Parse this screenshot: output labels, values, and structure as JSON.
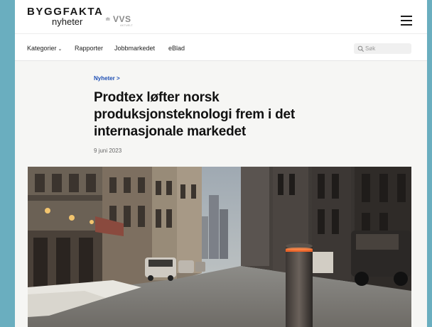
{
  "header": {
    "brand_main": "BYGGFAKTA",
    "brand_sub": "nyheter",
    "partner_name": "VVS",
    "partner_small": "AKTUELT",
    "partner_glyph": "≐",
    "menu_icon": "hamburger-menu-icon"
  },
  "nav": {
    "items": [
      {
        "label": "Kategorier",
        "has_dropdown": true
      },
      {
        "label": "Rapporter"
      },
      {
        "label": "Jobbmarkedet"
      },
      {
        "label": "eBlad"
      }
    ],
    "search_placeholder": "Søk",
    "search_icon": "magnifier-icon"
  },
  "article": {
    "breadcrumb": "Nyheter >",
    "title": "Prodtex løfter norsk produksjonsteknologi frem i det internasjonale markedet",
    "date": "9 juni 2023"
  },
  "colors": {
    "frame": "#6aaebf",
    "page_bg": "#f6f6f4",
    "accent_link": "#1e4fb4",
    "text": "#111111"
  }
}
